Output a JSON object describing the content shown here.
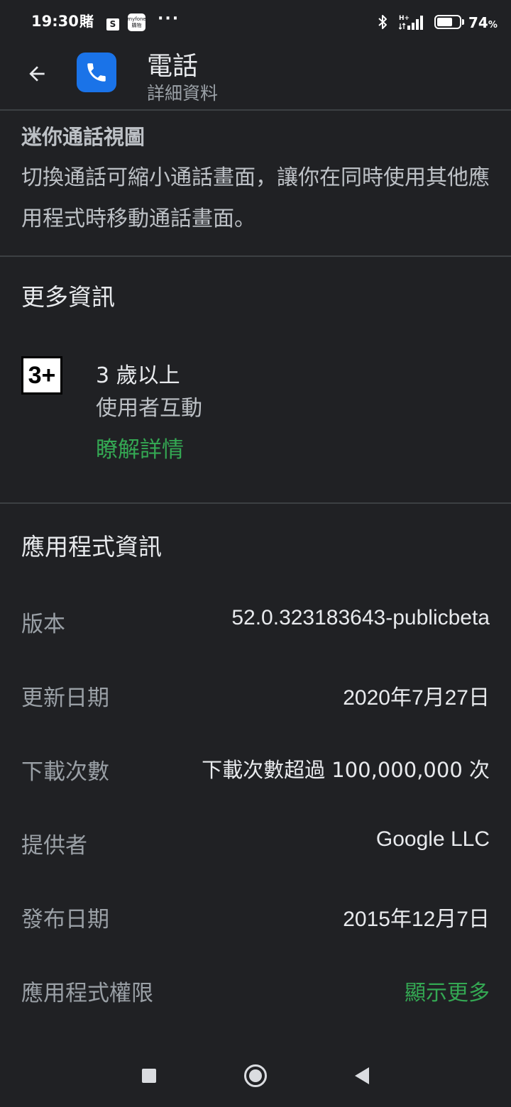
{
  "status_bar": {
    "time": "19:30",
    "notif_char": "賭",
    "bag_letter": "S",
    "myfone_top": "myfone",
    "myfone_bottom": "購物",
    "more_dots": "···",
    "network_type": "H+",
    "battery_level": 74,
    "battery_percent": "74",
    "percent_sign": "%"
  },
  "app_bar": {
    "title": "電話",
    "subtitle": "詳細資料"
  },
  "feature": {
    "title": "迷你通話視圖",
    "description": "切換通話可縮小通話畫面，讓你在同時使用其他應用程式時移動通話畫面。"
  },
  "more_info": {
    "heading": "更多資訊",
    "rating_badge": "3+",
    "rating_age": "3 歲以上",
    "rating_desc": "使用者互動",
    "learn_more": "瞭解詳情"
  },
  "app_info": {
    "heading": "應用程式資訊",
    "rows": [
      {
        "label": "版本",
        "value": "52.0.323183643-publicbeta"
      },
      {
        "label": "更新日期",
        "value": "2020年7月27日"
      },
      {
        "label": "下載次數",
        "value": "下載次數超過 100,000,000 次"
      },
      {
        "label": "提供者",
        "value": "Google LLC"
      },
      {
        "label": "發布日期",
        "value": "2015年12月7日"
      },
      {
        "label": "應用程式權限",
        "value": "顯示更多"
      }
    ]
  },
  "colors": {
    "background": "#202124",
    "accent_green": "#34a853",
    "app_icon_blue": "#1a73e8",
    "divider": "#3c4043"
  },
  "icons": {
    "back": "arrow-left-icon",
    "app": "phone-icon",
    "bluetooth": "bluetooth-icon",
    "signal": "signal-icon",
    "battery": "battery-icon"
  }
}
